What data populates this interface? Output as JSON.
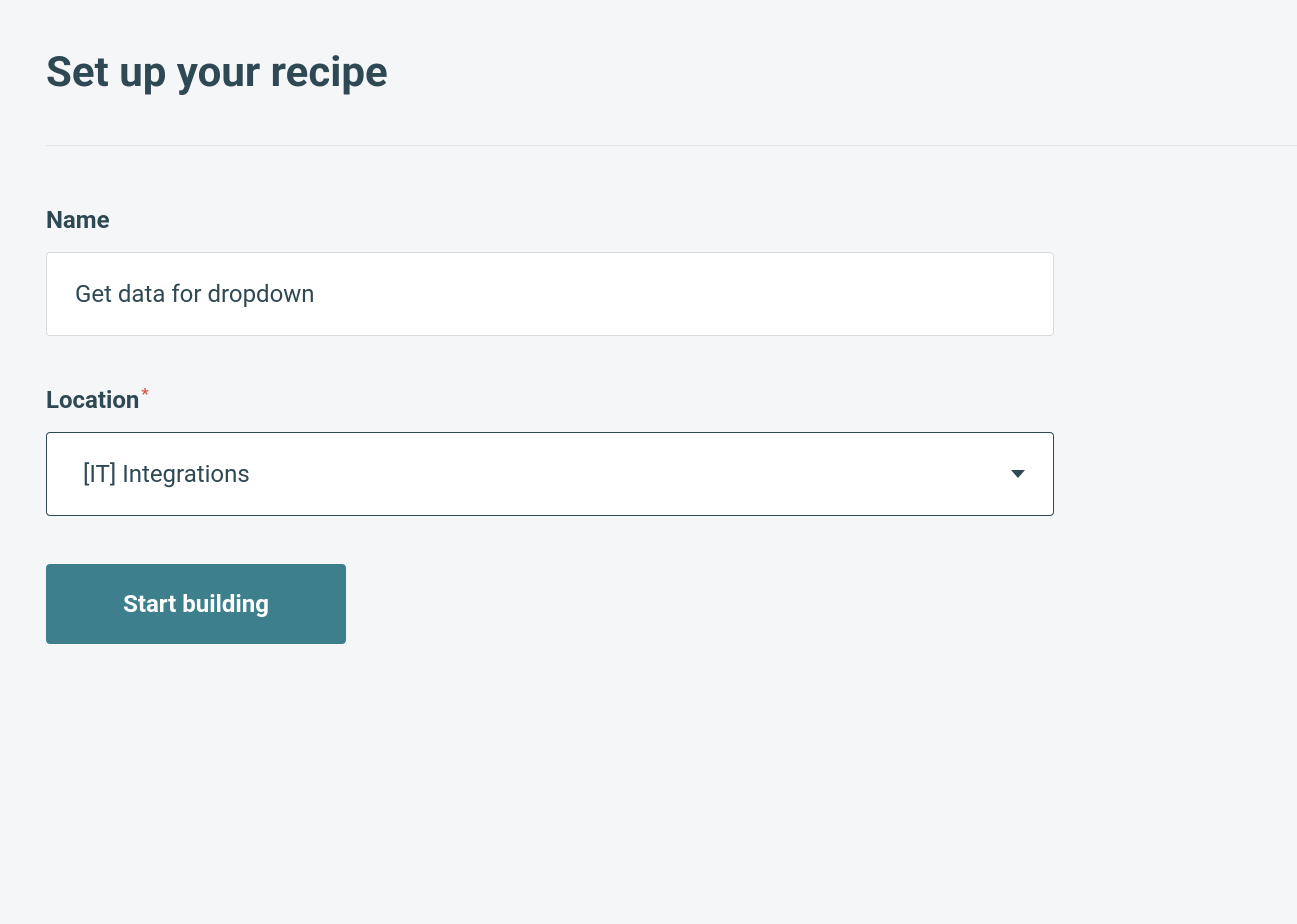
{
  "header": {
    "title": "Set up your recipe"
  },
  "form": {
    "name": {
      "label": "Name",
      "value": "Get data for dropdown",
      "required": false
    },
    "location": {
      "label": "Location",
      "value": "[IT] Integrations",
      "required": true
    },
    "submit_label": "Start building"
  }
}
